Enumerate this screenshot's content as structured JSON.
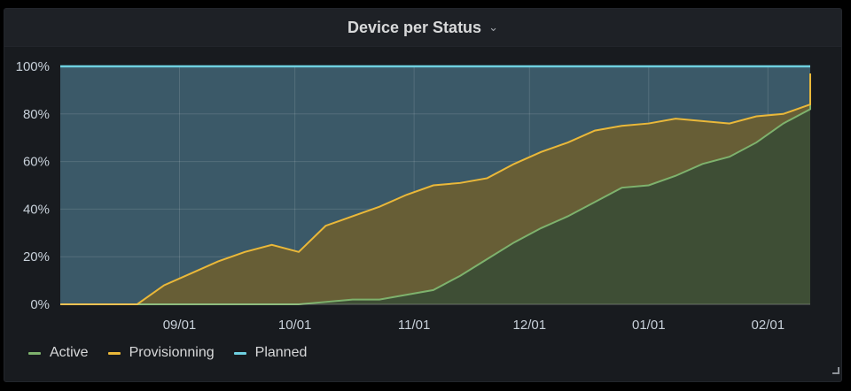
{
  "panel": {
    "title": "Device per Status"
  },
  "icons": {
    "chevron": "chevron-down-icon"
  },
  "chart_data": {
    "type": "area",
    "stacking": "percent",
    "ylim": [
      0,
      100
    ],
    "yticks": [
      "0%",
      "20%",
      "40%",
      "60%",
      "80%",
      "100%"
    ],
    "xtick_labels": [
      "09/01",
      "10/01",
      "11/01",
      "12/01",
      "01/01",
      "02/01"
    ],
    "xtick_positions": [
      "2021-09-01",
      "2021-10-01",
      "2021-11-01",
      "2021-12-01",
      "2022-01-01",
      "2022-02-01"
    ],
    "x": [
      "2021-08-01",
      "2021-08-07",
      "2021-08-14",
      "2021-08-21",
      "2021-08-28",
      "2021-09-04",
      "2021-09-11",
      "2021-09-18",
      "2021-09-25",
      "2021-10-02",
      "2021-10-09",
      "2021-10-16",
      "2021-10-23",
      "2021-10-30",
      "2021-11-06",
      "2021-11-13",
      "2021-11-20",
      "2021-11-27",
      "2021-12-04",
      "2021-12-11",
      "2021-12-18",
      "2021-12-25",
      "2022-01-01",
      "2022-01-08",
      "2022-01-15",
      "2022-01-22",
      "2022-01-29",
      "2022-02-05",
      "2022-02-12"
    ],
    "series": [
      {
        "name": "Active",
        "color": "#7eb26d",
        "values": [
          0,
          0,
          0,
          0,
          0,
          0,
          0,
          0,
          0,
          0,
          1,
          2,
          2,
          4,
          6,
          12,
          19,
          26,
          32,
          37,
          43,
          49,
          50,
          54,
          59,
          62,
          68,
          76,
          82
        ]
      },
      {
        "name": "Provisionning",
        "color": "#eab839",
        "values": [
          0,
          0,
          0,
          0,
          8,
          13,
          18,
          22,
          25,
          22,
          33,
          37,
          41,
          46,
          50,
          51,
          53,
          59,
          64,
          68,
          73,
          75,
          76,
          78,
          77,
          76,
          79,
          80,
          84
        ]
      },
      {
        "name": "Planned",
        "color": "#6ed0e0",
        "values": [
          100,
          100,
          100,
          100,
          100,
          100,
          100,
          100,
          100,
          100,
          100,
          100,
          100,
          100,
          100,
          100,
          100,
          100,
          100,
          100,
          100,
          100,
          100,
          100,
          100,
          100,
          100,
          100,
          100
        ]
      }
    ],
    "last_value_all": 97,
    "grid": true,
    "legend_position": "bottom-left"
  }
}
